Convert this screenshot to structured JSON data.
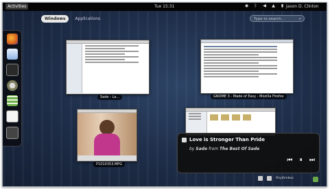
{
  "topbar": {
    "activities": "Activities",
    "clock": "Tue 15:31",
    "user": "Jason D. Clinton"
  },
  "viewselector": {
    "tabs": [
      "Windows",
      "Applications"
    ],
    "active": "Windows"
  },
  "search": {
    "placeholder": "Type to search..."
  },
  "windows": [
    {
      "caption": "Sade - La..."
    },
    {
      "caption": "GNOME 3 - Made of Easy - Mozilla Firefox"
    },
    {
      "caption": "P1010353.MPG"
    },
    {
      "caption": ""
    }
  ],
  "notification": {
    "title": "Love is Stronger Than Pride",
    "by": "by",
    "artist": "Sade",
    "from": "from",
    "album": "The Best Of Sade"
  },
  "messagetray": {
    "label": "Rhythmbox"
  },
  "colors": {
    "background": "#1d2c47",
    "topbar": "#050505",
    "active_tab": "#e8e8e8"
  }
}
